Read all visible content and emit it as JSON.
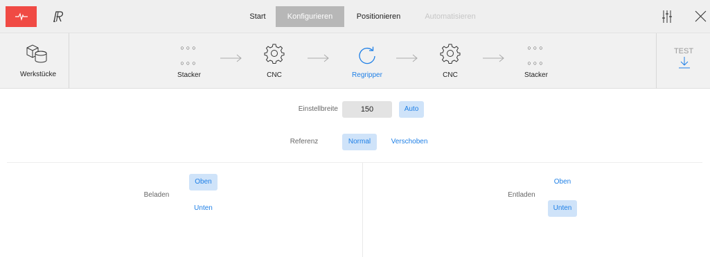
{
  "topbar": {
    "tabs": [
      {
        "label": "Start"
      },
      {
        "label": "Konfigurieren"
      },
      {
        "label": "Positionieren"
      },
      {
        "label": "Automatisieren"
      }
    ],
    "active_tab": "Konfigurieren",
    "disabled_tab": "Automatisieren",
    "icons": {
      "logo": "pulse-logo-icon",
      "brand": "r-logo-icon",
      "settings": "sliders-icon",
      "close": "close-icon"
    },
    "accent": "#f04a44"
  },
  "process": {
    "workpieces_label": "Werkstücke",
    "steps": [
      {
        "label": "Stacker",
        "icon": "dots-grid-icon"
      },
      {
        "label": "CNC",
        "icon": "gear-icon"
      },
      {
        "label": "Regripper",
        "icon": "rotate-icon",
        "active": true
      },
      {
        "label": "CNC",
        "icon": "gear-icon"
      },
      {
        "label": "Stacker",
        "icon": "dots-grid-icon"
      }
    ],
    "test_label": "TEST",
    "test_icon": "download-arrow-icon"
  },
  "settings": {
    "width_label": "Einstellbreite",
    "width_value": "150",
    "auto_label": "Auto",
    "reference_label": "Referenz",
    "reference_options": [
      "Normal",
      "Verschoben"
    ],
    "reference_selected": "Normal"
  },
  "load": {
    "label": "Beladen",
    "options": [
      "Oben",
      "Unten"
    ],
    "selected": "Oben"
  },
  "unload": {
    "label": "Entladen",
    "options": [
      "Oben",
      "Unten"
    ],
    "selected": "Unten"
  },
  "colors": {
    "selected_bg": "#cfe3f9",
    "link": "#1e7fe6",
    "active_tab_bg": "#b7b7b7"
  }
}
